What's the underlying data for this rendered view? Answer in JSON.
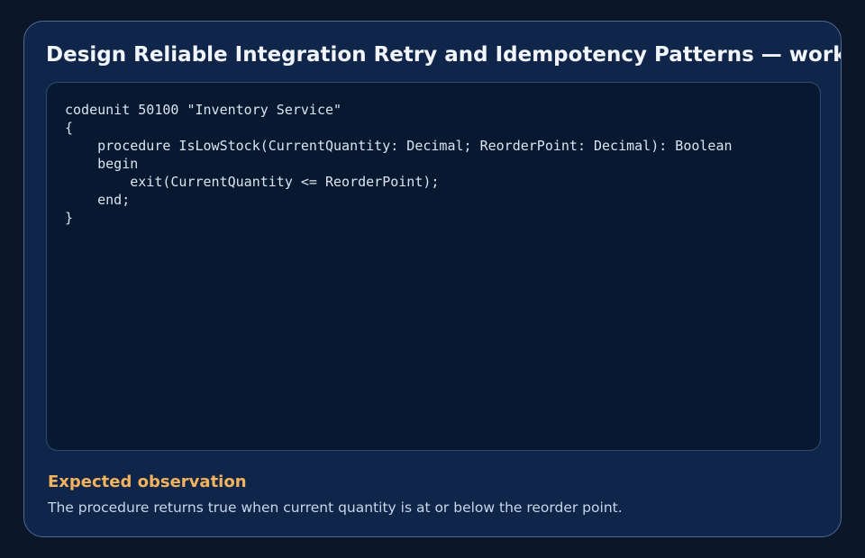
{
  "card": {
    "title": "Design Reliable Integration Retry and Idempotency Patterns — worked example"
  },
  "code": {
    "lines": [
      "codeunit 50100 \"Inventory Service\"",
      "{",
      "    procedure IsLowStock(CurrentQuantity: Decimal; ReorderPoint: Decimal): Boolean",
      "    begin",
      "        exit(CurrentQuantity <= ReorderPoint);",
      "    end;",
      "}"
    ]
  },
  "observation": {
    "label": "Expected observation",
    "text": "The procedure returns true when current quantity is at or below the reorder point."
  },
  "colors": {
    "page_background": "#0b1629",
    "card_background": "#0f2549",
    "code_background": "#061930",
    "accent": "#f3b35c"
  }
}
